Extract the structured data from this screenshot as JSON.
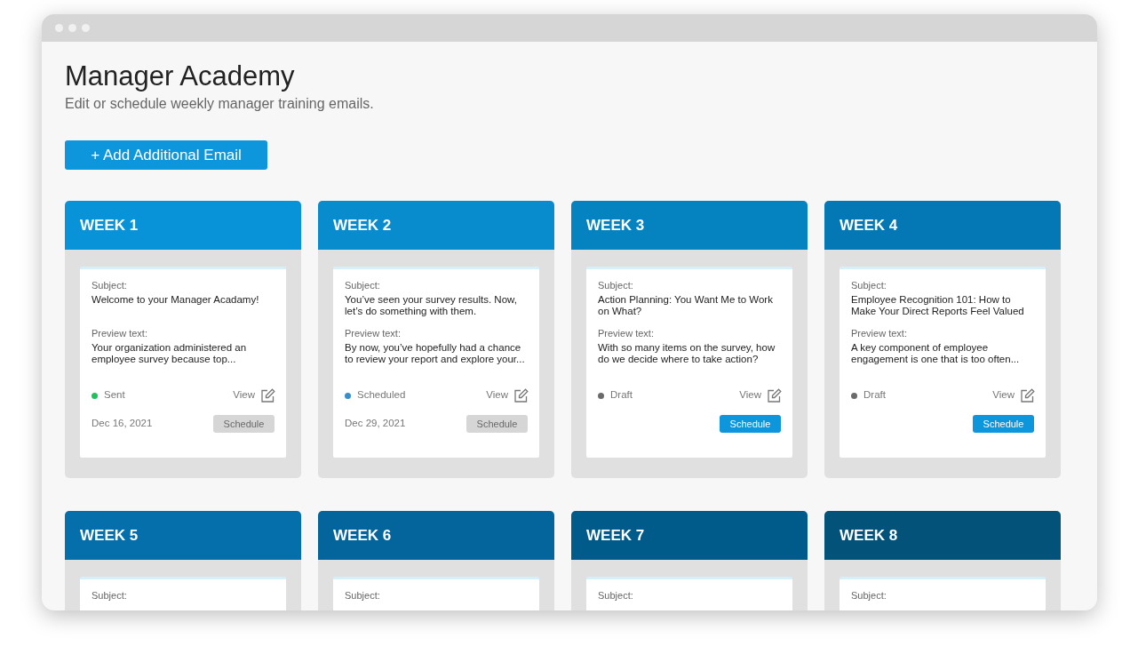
{
  "page": {
    "title": "Manager Academy",
    "subtitle": "Edit or schedule weekly manager training emails.",
    "add_button": "+ Add Additional Email"
  },
  "weeks": [
    {
      "label": "WEEK 1",
      "color": "#0893d8",
      "subject_label": "Subject:",
      "subject": "Welcome to your Manager Acadamy!",
      "preview_label": "Preview text:",
      "preview": "Your organization administered an employee survey because top...",
      "status": {
        "label": "Sent",
        "color": "#1fc25a"
      },
      "view": "View",
      "date": "Dec 16, 2021",
      "schedule": {
        "label": "Schedule",
        "disabled": true
      }
    },
    {
      "label": "WEEK 2",
      "color": "#088ccd",
      "subject_label": "Subject:",
      "subject": "You’ve seen your survey results. Now, let’s do something with them.",
      "preview_label": "Preview text:",
      "preview": "By now, you’ve hopefully had a chance to review your report and explore your...",
      "status": {
        "label": "Scheduled",
        "color": "#3a8dc8"
      },
      "view": "View",
      "date": "Dec 29, 2021",
      "schedule": {
        "label": "Schedule",
        "disabled": true
      }
    },
    {
      "label": "WEEK 3",
      "color": "#0582c0",
      "subject_label": "Subject:",
      "subject": "Action  Planning: You Want Me to Work on What?",
      "preview_label": "Preview text:",
      "preview": "With so many items on the survey, how do we decide where to take action?",
      "status": {
        "label": "Draft",
        "color": "#6b6b6b"
      },
      "view": "View",
      "schedule": {
        "label": "Schedule",
        "disabled": false
      }
    },
    {
      "label": "WEEK 4",
      "color": "#0378b4",
      "subject_label": "Subject:",
      "subject": "Employee Recognition 101: How to Make Your Direct Reports Feel Valued",
      "preview_label": "Preview text:",
      "preview": "A key component of employee engagement is one that is too often...",
      "status": {
        "label": "Draft",
        "color": "#6b6b6b"
      },
      "view": "View",
      "schedule": {
        "label": "Schedule",
        "disabled": false
      }
    },
    {
      "label": "WEEK 5",
      "color": "#046faa",
      "subject_label": "Subject:"
    },
    {
      "label": "WEEK 6",
      "color": "#03659b",
      "subject_label": "Subject:"
    },
    {
      "label": "WEEK 7",
      "color": "#015b8a",
      "subject_label": "Subject:"
    },
    {
      "label": "WEEK 8",
      "color": "#02527a",
      "subject_label": "Subject:"
    }
  ]
}
